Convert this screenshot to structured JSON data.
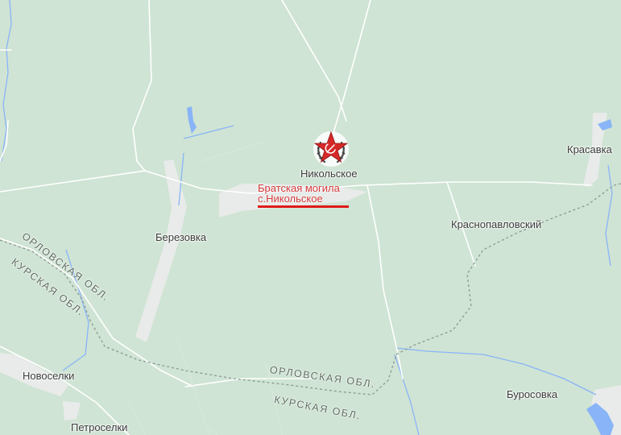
{
  "map": {
    "places": {
      "nikolskoe": "Никольское",
      "krasavka": "Красавка",
      "krasnopavlovsky": "Краснопавловский",
      "berezovka": "Березовка",
      "novoselki": "Новоселки",
      "petroselki": "Петроселки",
      "burosovka": "Буросовка"
    },
    "poi": {
      "line1": "Братская могила",
      "line2": "с.Никольское",
      "icon": "soviet-star-memorial-icon"
    },
    "borders": {
      "orel_upper": "ОРЛОВСКАЯ ОБЛ.",
      "kursk_upper": "КУРСКАЯ ОБЛ.",
      "orel_lower": "ОРЛОВСКАЯ ОБЛ.",
      "kursk_lower": "КУРСКАЯ ОБЛ."
    },
    "colors": {
      "land": "#cfe4d4",
      "road": "#ffffff",
      "settlement": "#e8ebe9",
      "water": "#8ab4f8",
      "border": "#8d9a92",
      "poi_text": "#d33a3a",
      "poi_underline": "#e01a1a",
      "star": "#d62828"
    }
  }
}
